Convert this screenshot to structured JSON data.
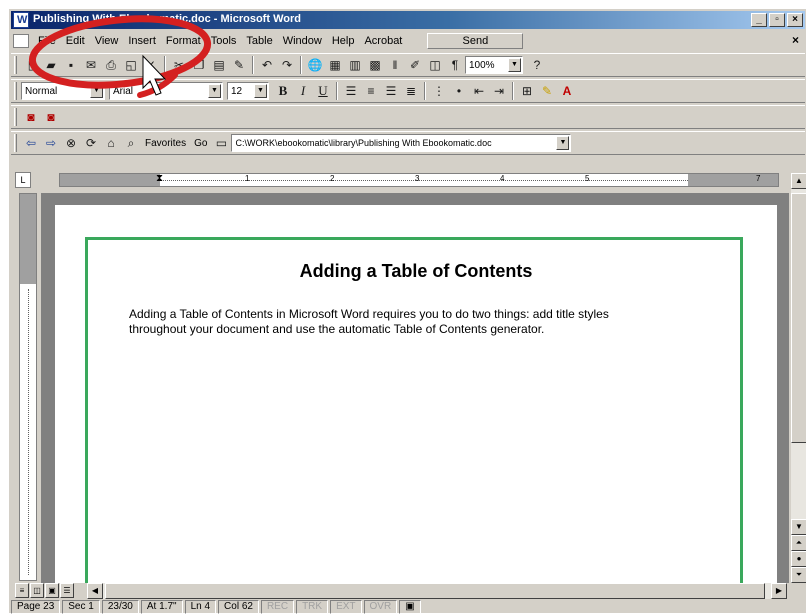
{
  "titlebar": {
    "title": "Publishing With Ebookomatic.doc - Microsoft Word",
    "minimize": "_",
    "maximize": "▫",
    "close": "×"
  },
  "menubar": {
    "items": [
      "File",
      "Edit",
      "View",
      "Insert",
      "Format",
      "Tools",
      "Table",
      "Window",
      "Help",
      "Acrobat"
    ],
    "send": "Send",
    "doc_close": "×"
  },
  "formatting": {
    "style": "Normal",
    "font": "Arial",
    "size": "12",
    "bold": "B",
    "italic": "I",
    "underline": "U"
  },
  "standard": {
    "zoom": "100%"
  },
  "web": {
    "favorites": "Favorites",
    "go": "Go",
    "address": "C:\\WORK\\ebookomatic\\library\\Publishing With Ebookomatic.doc"
  },
  "ruler": {
    "corner": "L",
    "numbers": [
      "1",
      "2",
      "3",
      "4",
      "5",
      "7"
    ]
  },
  "document": {
    "heading": "Adding a Table of Contents",
    "paragraph": "Adding a Table of Contents in Microsoft Word requires you to do two things: add title styles throughout your document and use the automatic Table of Contents generator."
  },
  "status": {
    "page": "Page 23",
    "sec": "Sec 1",
    "pages": "23/30",
    "at": "At 1.7\"",
    "ln": "Ln 4",
    "col": "Col 62",
    "rec": "REC",
    "trk": "TRK",
    "ext": "EXT",
    "ovr": "OVR"
  },
  "colors": {
    "titlebar": "#0a246a",
    "frame": "#3aa85c",
    "highlight_circle": "#d42020"
  }
}
